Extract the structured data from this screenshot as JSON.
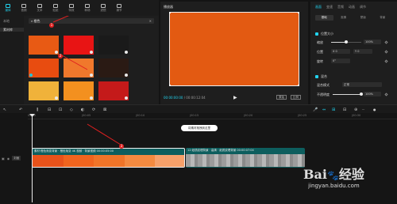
{
  "toolbar": {
    "items": [
      {
        "label": "媒体",
        "icon": "media-icon"
      },
      {
        "label": "音频",
        "icon": "audio-icon"
      },
      {
        "label": "文本",
        "icon": "text-icon"
      },
      {
        "label": "贴纸",
        "icon": "sticker-icon"
      },
      {
        "label": "特效",
        "icon": "effects-icon"
      },
      {
        "label": "转场",
        "icon": "transition-icon"
      },
      {
        "label": "滤镜",
        "icon": "filter-icon"
      },
      {
        "label": "调节",
        "icon": "adjust-icon"
      }
    ]
  },
  "leftnav": {
    "items": [
      "本地",
      "素材库"
    ]
  },
  "media": {
    "search_value": "橙色",
    "close_glyph": "✕",
    "thumbs": [
      "#e85a14",
      "#e81414",
      "#1a1a1a",
      "#e84c10",
      "#f0782c",
      "#2a1a14",
      "#f0b23a",
      "#f3901f",
      "#c41a1a"
    ]
  },
  "player": {
    "title": "播放器",
    "video_color": "#e35a12",
    "timecode_current": "00:00:00:00",
    "timecode_total": "/ 00:00:12:04",
    "play_glyph": "▶",
    "btn_full": "原始",
    "btn_ratio": "比例"
  },
  "inspector": {
    "tabs": [
      "画面",
      "变速",
      "音频",
      "动画",
      "调节"
    ],
    "subtabs": [
      "基础",
      "抠像",
      "蒙版",
      "背景"
    ],
    "section_pos": "位置大小",
    "scale_label": "缩放",
    "scale_value": "100%",
    "scale_fraction": 0.5,
    "pos_label": "位置",
    "pos_x": "X 0",
    "pos_y": "Y 0",
    "rotate_label": "旋转",
    "rotate_value": "0°",
    "section_blend": "混合",
    "blend_mode_label": "混合模式",
    "blend_mode_value": "正常",
    "opacity_label": "不透明度",
    "opacity_value": "100%",
    "opacity_fraction": 1.0
  },
  "tl_toolbar": {
    "left_icons": [
      "↖",
      "↶",
      "⫼",
      "⊟",
      "⊡",
      "◇",
      "◐",
      "⟳",
      "⊠"
    ],
    "right_icons": [
      "🎤",
      "⇔",
      "⊞",
      "⊟",
      "⊕",
      "─",
      "●"
    ]
  },
  "timeline": {
    "ticks": [
      "00:00",
      "|00:05",
      "|00:10",
      "|00:15",
      "|00:20",
      "|00:25",
      "|00:30"
    ],
    "tooltip": "将素材拖拽到这里",
    "track_cover": "封面",
    "clip1_label": "素材·橙色渐变背景 · 橙色渐变 4K 视频 · 背景视频   00:00:05:00",
    "clip2_label": "12·纸质纹理背景 · 高清 · 纸质纹理背景   00:00:07:04",
    "clip1_colors": [
      "#e8521a",
      "#f0641e",
      "#f07428",
      "#f48a40",
      "#f6a06a"
    ]
  },
  "annotations": [
    "1",
    "2",
    "3"
  ],
  "watermark": {
    "logo": "Bai 经验",
    "url": "jingyan.baidu.com"
  }
}
